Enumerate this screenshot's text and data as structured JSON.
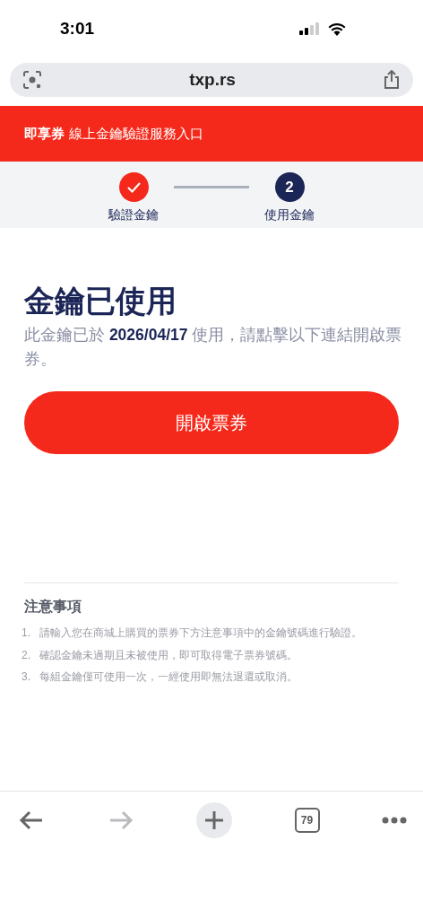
{
  "status_bar": {
    "time": "3:01"
  },
  "address_bar": {
    "url": "txp.rs"
  },
  "header": {
    "title": "**即享券** 線上金鑰驗證服務入口"
  },
  "steps": [
    {
      "label": "驗證金鑰",
      "completed": true
    },
    {
      "label": "使用金鑰",
      "completed": false,
      "number": "2"
    }
  ],
  "main": {
    "title": "金鑰已使用",
    "description": "此金鑰已於 **2026/04/17** 使用，請點擊以下連結開啟票券。",
    "button": "開啟票券"
  },
  "notes": {
    "title": "注意事項",
    "items": [
      {
        "number": "1.",
        "text": "請輸入您在商城上購買的票券下方注意事項中的金鑰號碼進行驗證。"
      },
      {
        "number": "2.",
        "text": "確認金鑰未過期且未被使用，即可取得電子票券號碼。"
      },
      {
        "number": "3.",
        "text": "每組金鑰僅可使用一次，一經使用即無法退還或取消。"
      }
    ]
  },
  "toolbar": [
    {
      "kind": "back",
      "disabled": false
    },
    {
      "kind": "forward",
      "disabled": true
    },
    {
      "kind": "new-tab",
      "disabled": false
    },
    {
      "kind": "tabs",
      "disabled": false,
      "count": "79"
    },
    {
      "kind": "more",
      "disabled": false
    }
  ]
}
